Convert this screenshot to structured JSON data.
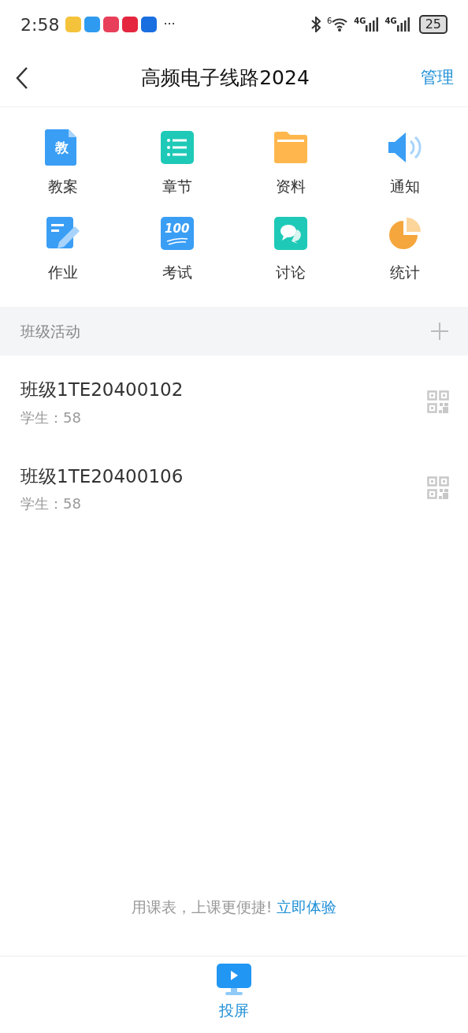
{
  "status_bar": {
    "time": "2:58",
    "notifications": [
      {
        "color": "#f5c33b"
      },
      {
        "color": "#2f9bf0"
      },
      {
        "color": "#e8405a"
      },
      {
        "color": "#e5263f"
      },
      {
        "color": "#1a6fe0"
      }
    ],
    "more": "···",
    "wifi_badge": "6",
    "signal_labels": [
      "4G",
      "4G"
    ],
    "battery": "25"
  },
  "header": {
    "title": "高频电子线路2024",
    "action": "管理"
  },
  "features": [
    {
      "kind": "doc",
      "glyph": "教",
      "label": "教案"
    },
    {
      "kind": "list",
      "label": "章节"
    },
    {
      "kind": "folder",
      "label": "资料"
    },
    {
      "kind": "speaker",
      "label": "通知"
    },
    {
      "kind": "edit",
      "label": "作业"
    },
    {
      "kind": "score",
      "glyph": "100",
      "label": "考试"
    },
    {
      "kind": "chat",
      "label": "讨论"
    },
    {
      "kind": "pie",
      "label": "统计"
    }
  ],
  "section": {
    "title": "班级活动"
  },
  "classes": [
    {
      "name": "班级1TE20400102",
      "students": "学生：58"
    },
    {
      "name": "班级1TE20400106",
      "students": "学生：58"
    }
  ],
  "promo": {
    "text": "用课表，上课更便捷!",
    "link": "立即体验"
  },
  "bottom_bar": {
    "label": "投屏"
  }
}
